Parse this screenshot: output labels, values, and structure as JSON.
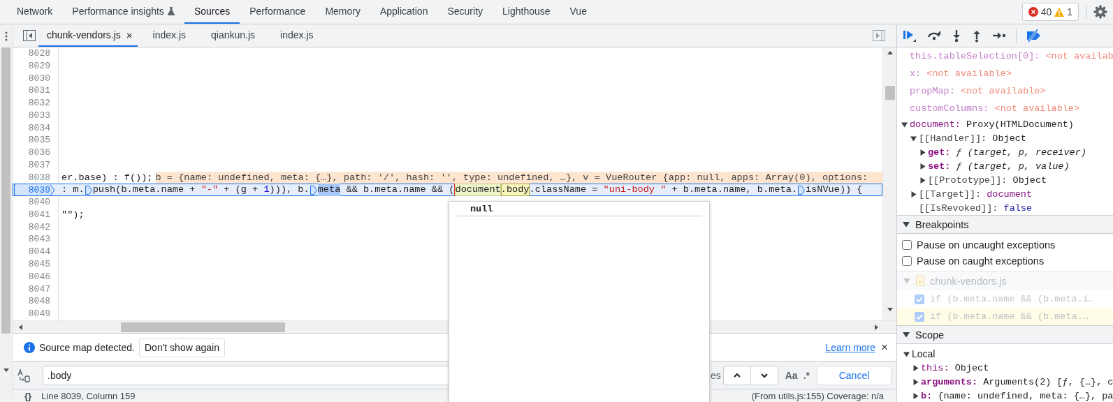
{
  "panel_tabs": [
    {
      "label": "Network",
      "selected": false,
      "kind": "plain"
    },
    {
      "label": "Performance insights",
      "selected": false,
      "kind": "experimental"
    },
    {
      "label": "Sources",
      "selected": true,
      "kind": "plain"
    },
    {
      "label": "Performance",
      "selected": false,
      "kind": "plain"
    },
    {
      "label": "Memory",
      "selected": false,
      "kind": "plain"
    },
    {
      "label": "Application",
      "selected": false,
      "kind": "plain"
    },
    {
      "label": "Security",
      "selected": false,
      "kind": "plain"
    },
    {
      "label": "Lighthouse",
      "selected": false,
      "kind": "plain"
    },
    {
      "label": "Vue",
      "selected": false,
      "kind": "plain"
    }
  ],
  "issues": {
    "errors": "40",
    "warnings": "1"
  },
  "file_tabs": [
    {
      "label": "chunk-vendors.js",
      "selected": true,
      "close": "×"
    },
    {
      "label": "index.js",
      "selected": false
    },
    {
      "label": "qiankun.js",
      "selected": false
    },
    {
      "label": "index.js",
      "selected": false
    }
  ],
  "editor": {
    "lines": [
      {
        "number": "8028",
        "paused": false
      },
      {
        "number": "8029",
        "paused": false
      },
      {
        "number": "8030",
        "paused": false
      },
      {
        "number": "8031",
        "paused": false
      },
      {
        "number": "8032",
        "paused": false
      },
      {
        "number": "8033",
        "paused": false
      },
      {
        "number": "8034",
        "paused": false
      },
      {
        "number": "8035",
        "paused": false
      },
      {
        "number": "8036",
        "paused": false
      },
      {
        "number": "8037",
        "paused": false
      },
      {
        "number": "8038",
        "paused": false,
        "tokens": [
          {
            "kind": "code",
            "text": "er.base) : f());"
          }
        ],
        "inline_value": "b = {name: undefined, meta: {…}, path: '/', hash: '', type: undefined, …}, v = VueRouter {app: null, apps: Array(0), options:"
      },
      {
        "number": "8039",
        "paused": true,
        "tokens": [
          {
            "kind": "code",
            "text": ": m."
          },
          {
            "kind": "step"
          },
          {
            "kind": "code",
            "text": "push(b.meta.name + "
          },
          {
            "kind": "string",
            "text": "\"-\""
          },
          {
            "kind": "code",
            "text": " + (g + "
          },
          {
            "kind": "number",
            "text": "1"
          },
          {
            "kind": "code",
            "text": "))), b."
          },
          {
            "kind": "step"
          },
          {
            "kind": "selection",
            "text": "meta"
          },
          {
            "kind": "code",
            "text": " && b.meta.name && ("
          },
          {
            "kind": "hover",
            "text": "document"
          },
          {
            "kind": "match",
            "text": ".body"
          },
          {
            "kind": "code",
            "text": ".className = "
          },
          {
            "kind": "string",
            "text": "\"uni-body \""
          },
          {
            "kind": "code",
            "text": " + b.meta.name, b.meta."
          },
          {
            "kind": "step"
          },
          {
            "kind": "code",
            "text": "isNVue)) {"
          }
        ]
      },
      {
        "number": "8040",
        "paused": false
      },
      {
        "number": "8041",
        "paused": false,
        "tokens": [
          {
            "kind": "code",
            "text": "\"\");"
          }
        ]
      },
      {
        "number": "8042",
        "paused": false
      },
      {
        "number": "8043",
        "paused": false
      },
      {
        "number": "8044",
        "paused": false
      },
      {
        "number": "8045",
        "paused": false
      },
      {
        "number": "8046",
        "paused": false
      },
      {
        "number": "8047",
        "paused": false
      },
      {
        "number": "8048",
        "paused": false
      },
      {
        "number": "8049",
        "paused": false
      }
    ]
  },
  "hover_popover": {
    "value": "null"
  },
  "info_bar": {
    "message": "Source map detected.",
    "button": "Don't show again",
    "link": "Learn more",
    "close": "×"
  },
  "search_bar": {
    "value": ".body",
    "match_count": "es",
    "case_toggle": "Aa",
    "regex_toggle": ".*",
    "cancel": "Cancel"
  },
  "status_bar": {
    "format": "{}",
    "position": "Line 8039, Column 159",
    "source": "(From utils.js:155) Coverage: n/a"
  },
  "watch": {
    "items": [
      {
        "name": {
          "text": "this.tableSelection[0]:",
          "kind": "faded"
        },
        "value": {
          "text": "<not availab",
          "kind": "unavailable"
        }
      },
      {
        "name": {
          "text": "x:",
          "kind": "faded"
        },
        "value": {
          "text": "<not available>",
          "kind": "unavailable"
        }
      },
      {
        "name": {
          "text": "propMap:",
          "kind": "faded"
        },
        "value": {
          "text": "<not available>",
          "kind": "unavailable"
        }
      },
      {
        "name": {
          "text": "customColumns:",
          "kind": "faded"
        },
        "value": {
          "text": "<not available>",
          "kind": "unavailable"
        }
      },
      {
        "name": {
          "text": "document:",
          "kind": "plain"
        },
        "value": {
          "text": "Proxy(HTMLDocument)",
          "kind": "object"
        },
        "expanded": true,
        "children": [
          {
            "name": {
              "text": "[[Handler]]:",
              "kind": "internal"
            },
            "value": {
              "text": "Object",
              "kind": "object"
            },
            "expanded": true,
            "children": [
              {
                "name": {
                  "text": "get:",
                  "kind": "own"
                },
                "value": {
                  "text": "ƒ (target, p, receiver)",
                  "kind": "function"
                },
                "expanded": false
              },
              {
                "name": {
                  "text": "set:",
                  "kind": "own"
                },
                "value": {
                  "text": "ƒ (target, p, value)",
                  "kind": "function"
                },
                "expanded": false
              },
              {
                "name": {
                  "text": "[[Prototype]]:",
                  "kind": "internal"
                },
                "value": {
                  "text": "Object",
                  "kind": "object"
                },
                "expanded": false
              }
            ]
          },
          {
            "name": {
              "text": "[[Target]]:",
              "kind": "internal"
            },
            "value": {
              "text": "document",
              "kind": "node"
            },
            "expanded": false
          },
          {
            "name": {
              "text": "[[IsRevoked]]:",
              "kind": "internal"
            },
            "value": {
              "text": "false",
              "kind": "keyword"
            }
          }
        ]
      }
    ]
  },
  "breakpoints": {
    "title": "Breakpoints",
    "expanded": true,
    "options": [
      {
        "label": "Pause on uncaught exceptions",
        "checked": false
      },
      {
        "label": "Pause on caught exceptions",
        "checked": false
      }
    ],
    "files": [
      {
        "name": "chunk-vendors.js",
        "expanded": true,
        "items": [
          {
            "code": "if (b.meta.name && (b.meta.i…",
            "checked": true,
            "selected": false
          },
          {
            "code": "if (b.meta.name && (b.meta.…",
            "checked": true,
            "selected": true
          }
        ]
      }
    ]
  },
  "scope": {
    "title": "Scope",
    "expanded": true,
    "items": [
      {
        "name": {
          "text": "Local",
          "kind": "group"
        },
        "expanded": true,
        "children": [
          {
            "name": {
              "text": "this:",
              "kind": "plain"
            },
            "value": {
              "text": "Object",
              "kind": "object"
            },
            "expanded": false
          },
          {
            "name": {
              "text": "arguments:",
              "kind": "own"
            },
            "value": {
              "text": "Arguments(2) [ƒ, {…}, c",
              "kind": "object"
            },
            "expanded": false
          },
          {
            "name": {
              "text": "b:",
              "kind": "own"
            },
            "value": {
              "text": "{name: undefined, meta: {…}, pa",
              "kind": "object"
            },
            "expanded": false
          }
        ]
      }
    ]
  }
}
